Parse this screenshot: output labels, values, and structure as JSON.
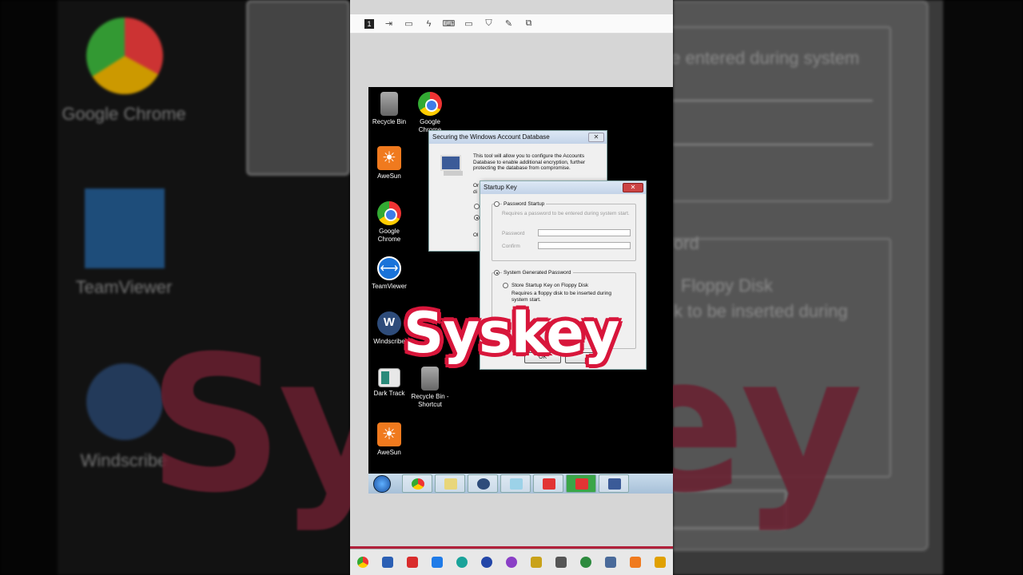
{
  "desktop_icons": [
    {
      "label": "Recycle Bin",
      "icon": "recycle-bin-icon"
    },
    {
      "label": "Google Chrome",
      "icon": "chrome-icon"
    },
    {
      "label": "AweSun",
      "icon": "awesun-icon"
    },
    {
      "label": "Google Chrome",
      "icon": "chrome-icon"
    },
    {
      "label": "TeamViewer",
      "icon": "teamviewer-icon"
    },
    {
      "label": "Windscribe",
      "icon": "windscribe-icon"
    },
    {
      "label": "Dark Track",
      "icon": "dark-track-icon"
    },
    {
      "label": "Recycle Bin - Shortcut",
      "icon": "recycle-bin-icon"
    },
    {
      "label": "AweSun",
      "icon": "awesun-icon"
    }
  ],
  "accounts_dialog": {
    "title": "Securing the Windows Account Database",
    "description": "This tool will allow you to configure the Accounts Database to enable additional encryption, further protecting the database from compromise.",
    "partial_option": "Or",
    "partial_option2": "di",
    "partial_button": "Ol"
  },
  "startup_key_dialog": {
    "title": "Startup Key",
    "close": "x",
    "password_startup": {
      "label": "Password Startup",
      "description": "Requires a password to be entered during system start.",
      "password_label": "Password",
      "confirm_label": "Confirm",
      "selected": false
    },
    "system_generated": {
      "label": "System Generated Password",
      "selected": true,
      "floppy_label": "Store Startup Key on Floppy Disk",
      "floppy_description": "Requires a floppy disk to be inserted during system start."
    },
    "ok_button": "OK"
  },
  "overlay_title": "Syskey",
  "background_text": {
    "left_chrome": "Google Chrome",
    "left_tv": "TeamViewer",
    "left_wind": "Windscribe",
    "right_1": "be entered during system",
    "right_2": "word",
    "right_3": "Floppy Disk",
    "right_4": "sk to be inserted during"
  },
  "viewer_toolbar": {
    "page_badge": "1"
  },
  "colors": {
    "accent_red": "#d8163b",
    "xp_title": "#c3d3e8"
  }
}
